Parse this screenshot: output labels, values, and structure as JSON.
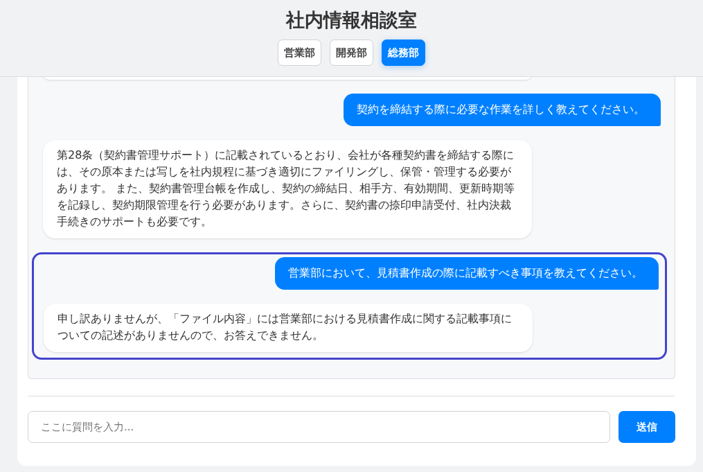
{
  "title": "社内情報相談室",
  "tabs": [
    {
      "label": "営業部",
      "selected": false
    },
    {
      "label": "開発部",
      "selected": false
    },
    {
      "label": "総務部",
      "selected": true
    }
  ],
  "messages": [
    {
      "kind": "user",
      "text": "契約を締結する際に必要な作業を詳しく教えてください。"
    },
    {
      "kind": "bot",
      "text": "第28条（契約書管理サポート）に記載されているとおり、会社が各種契約書を締結する際には、その原本または写しを社内規程に基づき適切にファイリングし、保管・管理する必要があります。 また、契約書管理台帳を作成し、契約の締結日、相手方、有効期間、更新時期等を記録し、契約期限管理を行う必要があります。さらに、契約書の捺印申請受付、社内決裁手続きのサポートも必要です。"
    }
  ],
  "highlighted_messages": [
    {
      "kind": "user",
      "text": "営業部において、見積書作成の際に記載すべき事項を教えてください。"
    },
    {
      "kind": "bot",
      "text": "申し訳ありませんが、「ファイル内容」には営業部における見積書作成に関する記載事項についての記述がありませんので、お答えできません。"
    }
  ],
  "input": {
    "placeholder": "ここに質問を入力..."
  },
  "send_button": "送信"
}
